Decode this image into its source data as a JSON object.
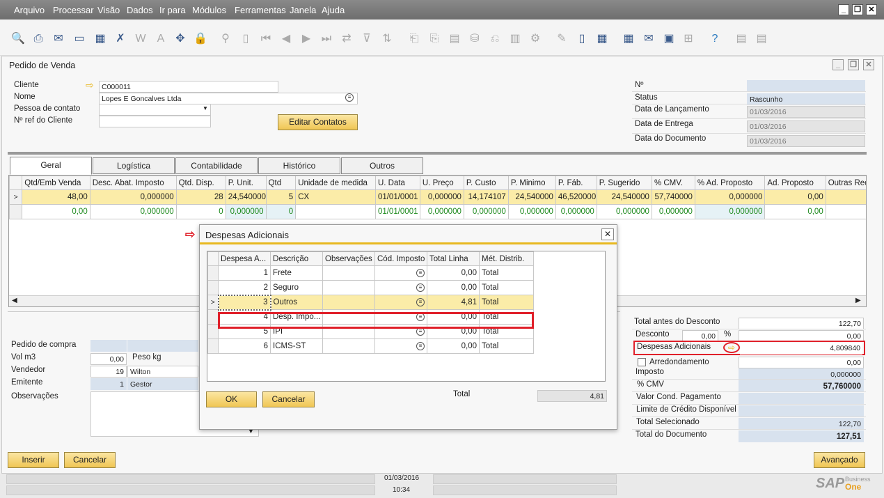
{
  "menu": [
    "Arquivo",
    "Processar",
    "Visão",
    "Dados",
    "Ir para",
    "Módulos",
    "Ferramentas",
    "Janela",
    "Ajuda"
  ],
  "window_title": "Pedido de Venda",
  "header_left": {
    "cliente_label": "Cliente",
    "cliente_value": "C000011",
    "nome_label": "Nome",
    "nome_value": "Lopes E Goncalves Ltda",
    "pessoa_label": "Pessoa de contato",
    "pessoa_value": "",
    "ref_label": "Nº ref do Cliente",
    "ref_value": "",
    "editar_contatos": "Editar Contatos"
  },
  "header_right": {
    "numero_label": "Nº",
    "numero_value": "",
    "status_label": "Status",
    "status_value": "Rascunho",
    "lanc_label": "Data de Lançamento",
    "lanc_value": "01/03/2016",
    "entrega_label": "Data de Entrega",
    "entrega_value": "01/03/2016",
    "doc_label": "Data do Documento",
    "doc_value": "01/03/2016"
  },
  "tabs": [
    "Geral",
    "Logística",
    "Contabilidade",
    "Histórico",
    "Outros"
  ],
  "grid": {
    "columns": [
      "Qtd/Emb Venda",
      "Desc. Abat. Imposto",
      "Qtd. Disp.",
      "P. Unit.",
      "Qtd",
      "Unidade de medida",
      "U. Data",
      "U. Preço",
      "P. Custo",
      "P. Minimo",
      "P. Fáb.",
      "P. Sugerido",
      "% CMV.",
      "% Ad. Proposto",
      "Ad. Proposto",
      "Outras Receitas"
    ],
    "rows": [
      [
        "48,00",
        "0,000000",
        "28",
        "24,540000",
        "5",
        "CX",
        "01/01/0001",
        "0,000000",
        "14,174107",
        "24,540000",
        "46,520000",
        "24,540000",
        "57,740000",
        "0,000000",
        "0,00",
        ""
      ],
      [
        "0,00",
        "0,000000",
        "0",
        "0,000000",
        "0",
        "",
        "01/01/0001",
        "0,000000",
        "0,000000",
        "0,000000",
        "0,000000",
        "0,000000",
        "0,000000",
        "0,000000",
        "0,00",
        ""
      ]
    ]
  },
  "lower_left": {
    "pedido_label": "Pedido de compra",
    "vol_label": "Vol m3",
    "vol_value": "0,00",
    "peso_label": "Peso kg",
    "vendedor_label": "Vendedor",
    "vendedor_code": "19",
    "vendedor_name": "Wilton",
    "emitente_label": "Emitente",
    "emitente_code": "1",
    "emitente_name": "Gestor",
    "obs_label": "Observações"
  },
  "totals": {
    "antes_label": "Total antes do Desconto",
    "antes_value": "122,70",
    "desconto_label": "Desconto",
    "desconto_pct": "0,00",
    "pct_sign": "%",
    "desconto_value": "0,00",
    "despesas_label": "Despesas Adicionais",
    "despesas_value": "4,809840",
    "arred_label": "Arredondamento",
    "arred_value": "0,00",
    "imposto_label": "Imposto",
    "imposto_value": "0,000000",
    "cmv_label": "% CMV",
    "cmv_value": "57,760000",
    "valor_cond_label": "Valor Cond. Pagamento",
    "limite_label": "Limite de Crédito Disponível",
    "selecionado_label": "Total Selecionado",
    "selecionado_value": "122,70",
    "documento_label": "Total do Documento",
    "documento_value": "127,51"
  },
  "buttons": {
    "inserir": "Inserir",
    "cancelar": "Cancelar",
    "avancado": "Avançado"
  },
  "dialog": {
    "title": "Despesas Adicionais",
    "columns": [
      "Despesa A...",
      "Descrição",
      "Observações",
      "Cód. Imposto",
      "Total Linha",
      "Mét. Distrib."
    ],
    "rows": [
      [
        "1",
        "Frete",
        "",
        "",
        "0,00",
        "Total"
      ],
      [
        "2",
        "Seguro",
        "",
        "",
        "0,00",
        "Total"
      ],
      [
        "3",
        "Outros",
        "",
        "",
        "4,81",
        "Total"
      ],
      [
        "4",
        "Desp. Impo...",
        "",
        "",
        "0,00",
        "Total"
      ],
      [
        "5",
        "IPI",
        "",
        "",
        "0,00",
        "Total"
      ],
      [
        "6",
        "ICMS-ST",
        "",
        "",
        "0,00",
        "Total"
      ]
    ],
    "total_label": "Total",
    "total_value": "4,81",
    "ok": "OK",
    "cancelar": "Cancelar"
  },
  "statusbar": {
    "date": "01/03/2016",
    "time": "10:34",
    "brand": "SAP",
    "brand_sub1": "Business",
    "brand_sub2": "One"
  },
  "colors": {
    "highlight_red": "#e0202a",
    "accent_yellow": "#f0c654",
    "row_yellow": "#fbeca8"
  }
}
